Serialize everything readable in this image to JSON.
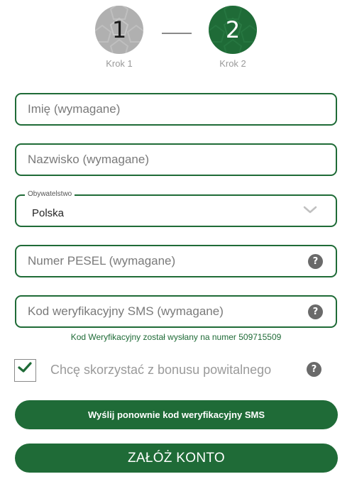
{
  "steps": [
    {
      "number": "1",
      "label": "Krok 1"
    },
    {
      "number": "2",
      "label": "Krok 2"
    }
  ],
  "form": {
    "first_name": {
      "placeholder": "Imię (wymagane)",
      "value": ""
    },
    "last_name": {
      "placeholder": "Nazwisko (wymagane)",
      "value": ""
    },
    "citizenship": {
      "label": "Obywatelstwo",
      "value": "Polska"
    },
    "pesel": {
      "placeholder": "Numer PESEL (wymagane)",
      "value": ""
    },
    "sms_code": {
      "placeholder": "Kod weryfikacyjny SMS (wymagane)",
      "value": ""
    },
    "sms_note": "Kod Weryfikacyjny został wysłany na numer 509715509",
    "bonus": {
      "label": "Chcę skorzystać z bonusu powitalnego",
      "checked": true
    }
  },
  "buttons": {
    "resend": "Wyślij ponownie kod weryfikacyjny SMS",
    "create": "ZAŁÓŻ KONTO"
  },
  "icons": {
    "help": "?",
    "dropdown": "chevron-down-icon",
    "checkmark": "check-icon"
  },
  "colors": {
    "primary": "#1f6b37",
    "step_inactive": "#b0b0b0",
    "placeholder": "#7a7a7a",
    "help_icon": "#6a6a6a"
  }
}
